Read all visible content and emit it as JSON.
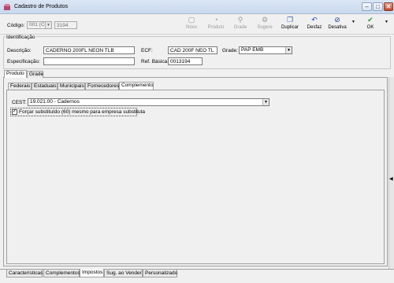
{
  "window": {
    "title": "Cadastro de Produtos",
    "controls": {
      "minimize": "–",
      "maximize": "□",
      "close": "✕"
    }
  },
  "toolbar": {
    "codigo_label": "Código:",
    "codigo_combo": "001 (Cl",
    "codigo_value": "3194",
    "buttons": [
      {
        "label": "Novo",
        "icon": "new-icon",
        "glyph": "▢",
        "enabled": false
      },
      {
        "label": "Produto",
        "icon": "product-icon",
        "glyph": "◔",
        "enabled": false
      },
      {
        "label": "Grade",
        "icon": "grid-icon",
        "glyph": "⚲",
        "enabled": false
      },
      {
        "label": "Sugere",
        "icon": "suggest-icon",
        "glyph": "⚙",
        "enabled": false
      },
      {
        "label": "Duplicar",
        "icon": "duplicate-icon",
        "glyph": "❐",
        "enabled": true
      },
      {
        "label": "Desfaz",
        "icon": "undo-icon",
        "glyph": "↶",
        "enabled": true
      },
      {
        "label": "Desativa",
        "icon": "deactivate-icon",
        "glyph": "⊘",
        "enabled": true
      },
      {
        "label": "OK",
        "icon": "check-icon",
        "glyph": "✔",
        "enabled": true
      }
    ],
    "colors": {
      "undo": "#1f4fbf",
      "deactivate": "#1b3b8a",
      "ok": "#2e9a2e"
    }
  },
  "identificacao": {
    "legend": "Identificação",
    "descricao_label": "Descrição:",
    "descricao_value": "CADERNO 200FL NEON TLB",
    "ecf_label": "ECF:",
    "ecf_value": "CAD 200F NEO TL",
    "grade_label": "Grade:",
    "grade_value": "PAP EMB",
    "especificacao_label": "Especificação:",
    "especificacao_value": "",
    "ref_basica_label": "Ref. Básica:",
    "ref_basica_value": "0013194"
  },
  "main_tabs": [
    {
      "label": "Produto",
      "active": true
    },
    {
      "label": "Grade",
      "active": false
    }
  ],
  "sub_tabs": [
    {
      "label": "Federais",
      "active": false
    },
    {
      "label": "Estaduais",
      "active": false
    },
    {
      "label": "Municipais",
      "active": false
    },
    {
      "label": "Fornecedores",
      "active": false
    },
    {
      "label": "Complemento",
      "active": true
    }
  ],
  "complemento": {
    "cest_label": "CEST:",
    "cest_value": "19.021.00 - Cadernos",
    "checkbox_label": "Forçar substituído (60) mesmo para empresa substituta",
    "checkbox_checked": true
  },
  "bottom_tabs": [
    {
      "label": "Características",
      "active": false
    },
    {
      "label": "Complementos",
      "active": false
    },
    {
      "label": "Impostos",
      "active": true
    },
    {
      "label": "Sug. ao Vender",
      "active": false
    },
    {
      "label": "Personalizado",
      "active": false
    }
  ]
}
